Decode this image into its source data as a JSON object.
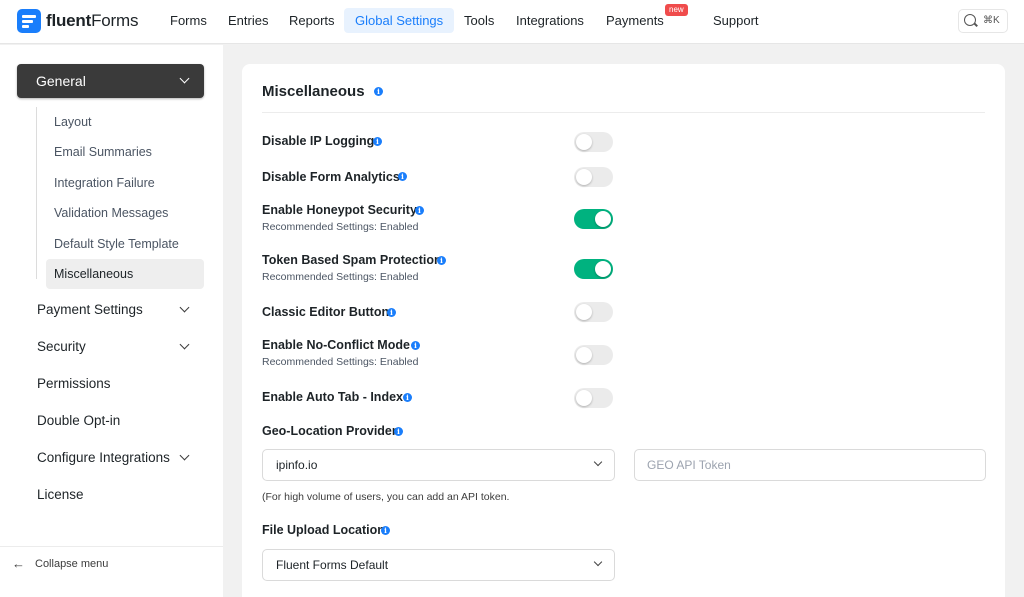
{
  "app": {
    "logo_bold": "fluent",
    "logo_light": "Forms",
    "brand_color": "#1a7efb"
  },
  "nav": {
    "items": [
      {
        "label": "Forms"
      },
      {
        "label": "Entries"
      },
      {
        "label": "Reports"
      },
      {
        "label": "Global Settings",
        "active": true
      },
      {
        "label": "Tools"
      },
      {
        "label": "Integrations"
      },
      {
        "label": "Payments",
        "badge": "new"
      },
      {
        "label": "Support"
      }
    ],
    "search_shortcut": "⌘K",
    "search_icon": "search-icon"
  },
  "sidebar": {
    "section": "General",
    "sub_items": [
      {
        "label": "Layout"
      },
      {
        "label": "Email Summaries"
      },
      {
        "label": "Integration Failure"
      },
      {
        "label": "Validation Messages"
      },
      {
        "label": "Default Style Template"
      },
      {
        "label": "Miscellaneous",
        "active": true
      }
    ],
    "items": [
      {
        "label": "Payment Settings",
        "expandable": true
      },
      {
        "label": "Security",
        "expandable": true
      },
      {
        "label": "Permissions",
        "expandable": false
      },
      {
        "label": "Double Opt-in",
        "expandable": false
      },
      {
        "label": "Configure Integrations",
        "expandable": true
      },
      {
        "label": "License",
        "expandable": false
      }
    ],
    "collapse_label": "Collapse menu",
    "collapse_arrow": "←"
  },
  "main": {
    "title": "Miscellaneous",
    "info_glyph": "i",
    "settings": [
      {
        "label": "Disable IP Logging",
        "enabled": false
      },
      {
        "label": "Disable Form Analytics",
        "enabled": false
      },
      {
        "label": "Enable Honeypot Security",
        "sub": "Recommended Settings: Enabled",
        "enabled": true
      },
      {
        "label": "Token Based Spam Protection",
        "sub": "Recommended Settings: Enabled",
        "enabled": true
      },
      {
        "label": "Classic Editor Button",
        "enabled": false
      },
      {
        "label": "Enable No-Conflict Mode",
        "sub": "Recommended Settings: Enabled",
        "enabled": false
      },
      {
        "label": "Enable Auto Tab - Index",
        "enabled": false
      }
    ],
    "geo": {
      "label": "Geo-Location Provider",
      "selected": "ipinfo.io",
      "token_placeholder": "GEO API Token",
      "help": "(For high volume of users, you can add an API token."
    },
    "upload": {
      "label": "File Upload Location",
      "selected": "Fluent Forms Default"
    },
    "colors": {
      "toggle_on": "#00b27f",
      "toggle_off": "#ebebeb",
      "badge": "#f04c4c"
    }
  }
}
